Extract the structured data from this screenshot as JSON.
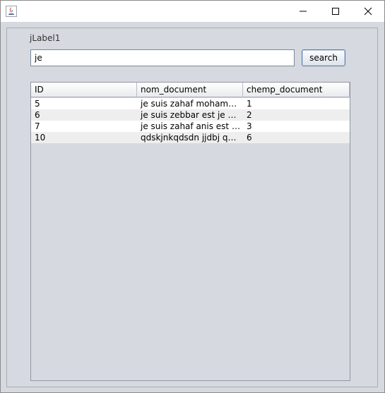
{
  "window": {
    "title": "",
    "app_icon": "java-icon",
    "controls": [
      "minimize-icon",
      "maximize-icon",
      "close-icon"
    ]
  },
  "form": {
    "label": "jLabel1",
    "search_value": "je",
    "search_button_label": "search"
  },
  "table": {
    "columns": [
      "ID",
      "nom_document",
      "chemp_document"
    ],
    "rows": [
      [
        "5",
        "je suis zahaf mohamed...",
        "1"
      ],
      [
        "6",
        "je suis zebbar est je sui...",
        "2"
      ],
      [
        "7",
        "je suis zahaf anis est je...",
        "3"
      ],
      [
        "10",
        "qdskjnkqdsdn jjdbj qdvy...",
        "6"
      ]
    ]
  },
  "colors": {
    "background": "#d6d9df",
    "row_alt": "#eeeeee",
    "button_border": "#5a7da6"
  }
}
